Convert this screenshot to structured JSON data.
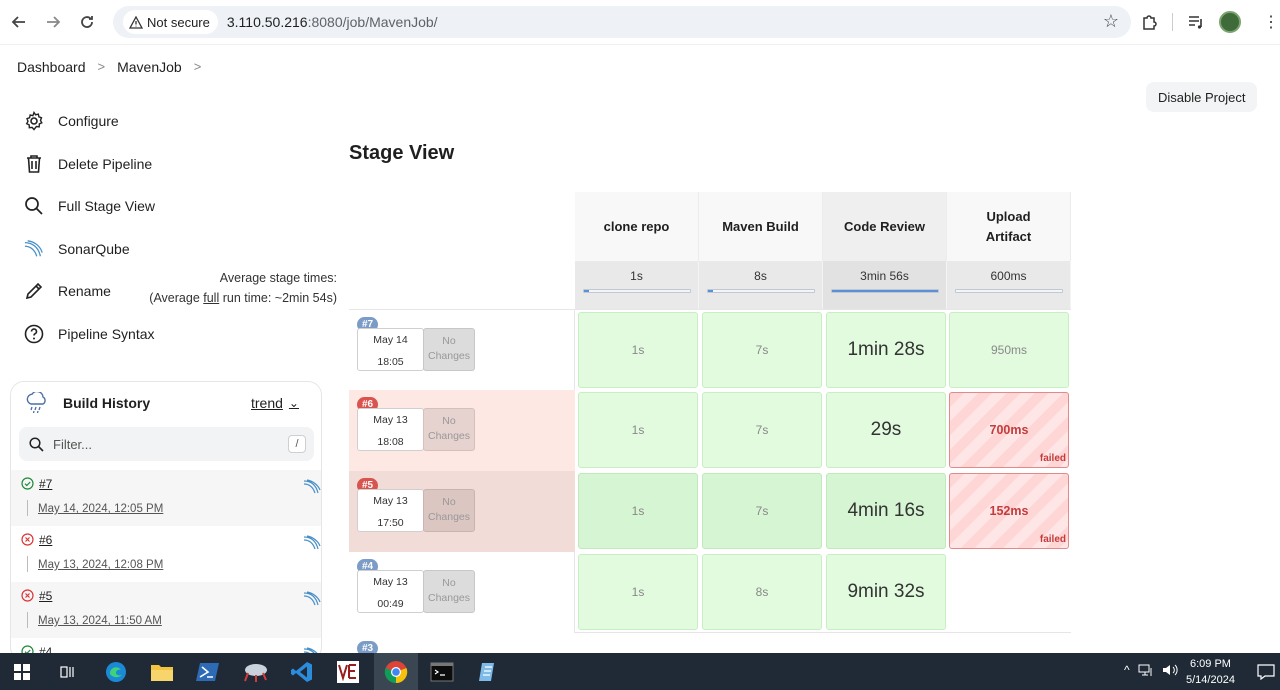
{
  "browser": {
    "security_label": "Not secure",
    "url_host": "3.110.50.216",
    "url_path": ":8080/job/MavenJob/"
  },
  "breadcrumb": [
    "Dashboard",
    "MavenJob"
  ],
  "sidebar": {
    "items": [
      {
        "label": "Configure",
        "icon": "gear-icon"
      },
      {
        "label": "Delete Pipeline",
        "icon": "trash-icon"
      },
      {
        "label": "Full Stage View",
        "icon": "search-icon"
      },
      {
        "label": "SonarQube",
        "icon": "sonarqube-icon"
      },
      {
        "label": "Rename",
        "icon": "pencil-icon"
      },
      {
        "label": "Pipeline Syntax",
        "icon": "help-icon"
      }
    ]
  },
  "actions": {
    "disable_project": "Disable Project"
  },
  "build_history": {
    "title": "Build History",
    "trend_label": "trend",
    "filter_placeholder": "Filter...",
    "filter_shortcut": "/",
    "builds": [
      {
        "number": "#7",
        "date": "May 14, 2024, 12:05 PM",
        "status": "success"
      },
      {
        "number": "#6",
        "date": "May 13, 2024, 12:08 PM",
        "status": "failed"
      },
      {
        "number": "#5",
        "date": "May 13, 2024, 11:50 AM",
        "status": "failed"
      },
      {
        "number": "#4",
        "date": "",
        "status": "success"
      }
    ]
  },
  "stage_view": {
    "title": "Stage View",
    "avg_label": "Average stage times:",
    "avg_run_prefix": "(Average ",
    "avg_run_link": "full",
    "avg_run_suffix": " run time: ~2min 54s)",
    "stages": [
      {
        "name": "clone repo",
        "avg": "1s",
        "fill": 0.05
      },
      {
        "name": "Maven Build",
        "avg": "8s",
        "fill": 0.05
      },
      {
        "name": "Code Review",
        "avg": "3min 56s",
        "fill": 1.0
      },
      {
        "name": "Upload Artifact",
        "avg": "600ms",
        "fill": 0.0
      }
    ],
    "runs": [
      {
        "badge": "#7",
        "month_day": "May 14",
        "time": "18:05",
        "changes": "No Changes",
        "status": "success",
        "cells": [
          "1s",
          "7s",
          "1min 28s",
          "950ms"
        ]
      },
      {
        "badge": "#6",
        "month_day": "May 13",
        "time": "18:08",
        "changes": "No Changes",
        "status": "failed",
        "cells": [
          "1s",
          "7s",
          "29s",
          "700ms"
        ]
      },
      {
        "badge": "#5",
        "month_day": "May 13",
        "time": "17:50",
        "changes": "No Changes",
        "status": "failed",
        "cells": [
          "1s",
          "7s",
          "4min 16s",
          "152ms"
        ]
      },
      {
        "badge": "#4",
        "month_day": "May 13",
        "time": "00:49",
        "changes": "No Changes",
        "status": "success",
        "cells": [
          "1s",
          "8s",
          "9min 32s",
          ""
        ]
      }
    ],
    "next_badge": "#3",
    "failed_label": "failed"
  },
  "taskbar": {
    "time": "6:09 PM",
    "date": "5/14/2024"
  },
  "colors": {
    "badge_success": "#7a9cc6",
    "badge_failed": "#d9534f",
    "row_failed": "#fde8e4",
    "row_failed_dark": "#f2dcd8"
  }
}
